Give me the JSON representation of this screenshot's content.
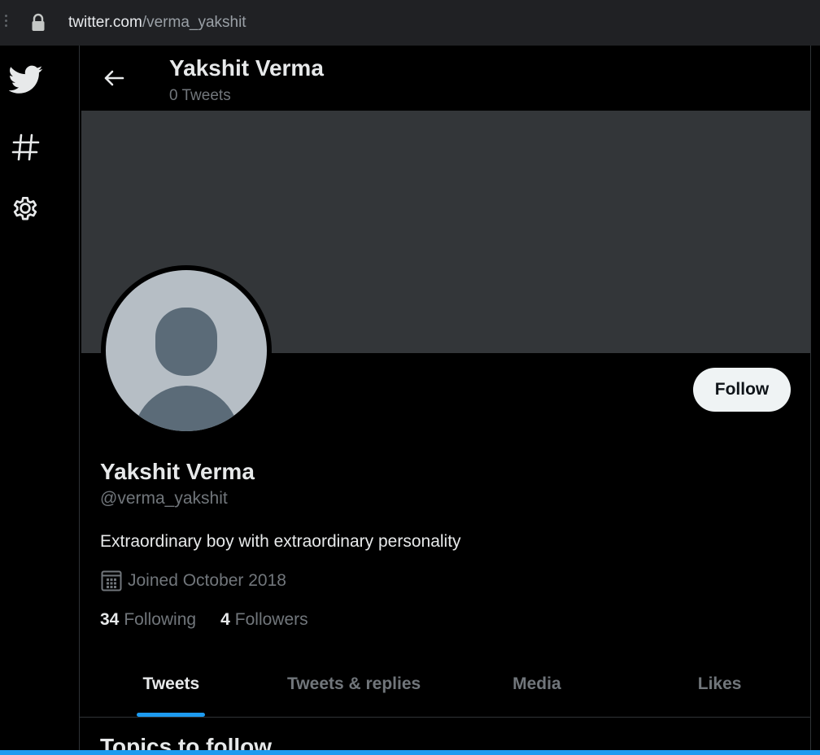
{
  "browser": {
    "url_host": "twitter.com",
    "url_path": "/verma_yakshit"
  },
  "nav": {
    "items": [
      {
        "icon": "twitter-bird-icon"
      },
      {
        "icon": "hashtag-icon"
      },
      {
        "icon": "settings-gear-icon"
      }
    ]
  },
  "header": {
    "name": "Yakshit Verma",
    "tweet_count": "0 Tweets"
  },
  "profile": {
    "name": "Yakshit Verma",
    "handle": "@verma_yakshit",
    "bio": "Extraordinary boy with extraordinary personality",
    "joined": "Joined October 2018",
    "following_count": "34",
    "following_label": "Following",
    "followers_count": "4",
    "followers_label": "Followers",
    "follow_button": "Follow"
  },
  "tabs": [
    {
      "label": "Tweets",
      "active": true
    },
    {
      "label": "Tweets & replies",
      "active": false
    },
    {
      "label": "Media",
      "active": false
    },
    {
      "label": "Likes",
      "active": false
    }
  ],
  "section": {
    "topics_title": "Topics to follow"
  },
  "colors": {
    "accent": "#1d9bf0",
    "background": "#000000",
    "banner": "#333639",
    "secondary_text": "#71767b"
  }
}
